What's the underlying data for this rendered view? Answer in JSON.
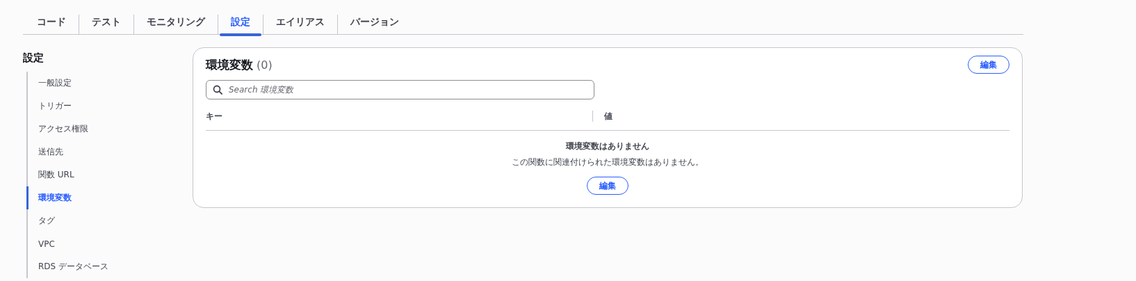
{
  "tabs": [
    {
      "label": "コード",
      "selected": false
    },
    {
      "label": "テスト",
      "selected": false
    },
    {
      "label": "モニタリング",
      "selected": false
    },
    {
      "label": "設定",
      "selected": true
    },
    {
      "label": "エイリアス",
      "selected": false
    },
    {
      "label": "バージョン",
      "selected": false
    }
  ],
  "sidebar": {
    "title": "設定",
    "items": [
      {
        "label": "一般設定",
        "selected": false
      },
      {
        "label": "トリガー",
        "selected": false
      },
      {
        "label": "アクセス権限",
        "selected": false
      },
      {
        "label": "送信先",
        "selected": false
      },
      {
        "label": "関数 URL",
        "selected": false
      },
      {
        "label": "環境変数",
        "selected": true
      },
      {
        "label": "タグ",
        "selected": false
      },
      {
        "label": "VPC",
        "selected": false
      },
      {
        "label": "RDS データベース",
        "selected": false
      }
    ]
  },
  "panel": {
    "title": "環境変数",
    "count": "(0)",
    "edit_button": "編集",
    "search": {
      "placeholder": "Search 環境変数"
    },
    "columns": [
      "キー",
      "値"
    ],
    "empty": {
      "title": "環境変数はありません",
      "message": "この関数に関連付けられた環境変数はありません。",
      "button": "編集"
    }
  }
}
